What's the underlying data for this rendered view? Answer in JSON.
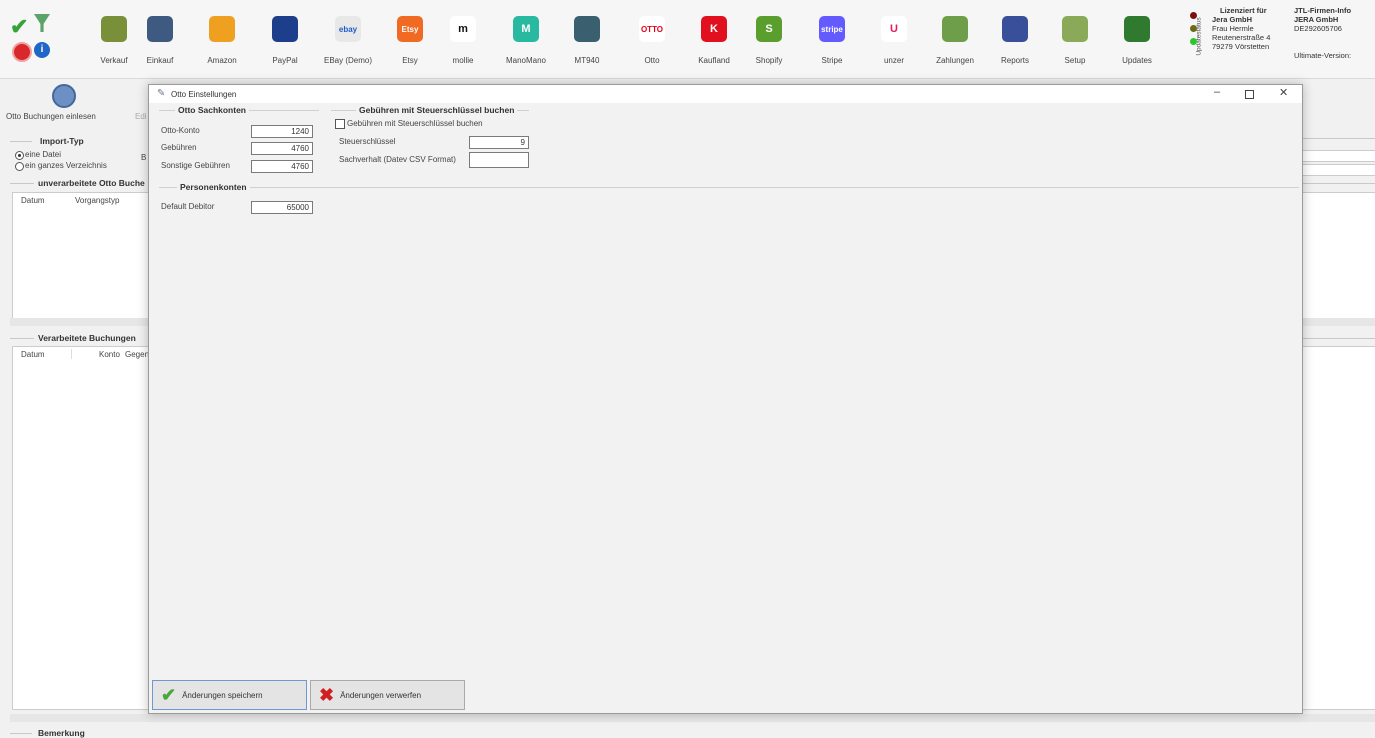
{
  "toolbar": {
    "items": [
      {
        "label": "Verkauf",
        "icon": "cart-icon"
      },
      {
        "label": "Einkauf",
        "icon": "purchase-icon"
      },
      {
        "label": "Amazon",
        "icon": "amazon-icon"
      },
      {
        "label": "PayPal",
        "icon": "paypal-icon"
      },
      {
        "label": "EBay (Demo)",
        "icon": "ebay-icon",
        "icon_text": "ebay"
      },
      {
        "label": "Etsy",
        "icon": "etsy-icon",
        "icon_text": "Etsy"
      },
      {
        "label": "mollie",
        "icon": "mollie-icon",
        "icon_text": "m"
      },
      {
        "label": "ManoMano",
        "icon": "manomano-icon",
        "icon_text": "M"
      },
      {
        "label": "MT940",
        "icon": "mt940-icon"
      },
      {
        "label": "Otto",
        "icon": "otto-icon",
        "icon_text": "OTTO"
      },
      {
        "label": "Kaufland",
        "icon": "kaufland-icon",
        "icon_text": "K"
      },
      {
        "label": "Shopify",
        "icon": "shopify-icon",
        "icon_text": "S"
      },
      {
        "label": "Stripe",
        "icon": "stripe-icon",
        "icon_text": "stripe"
      },
      {
        "label": "unzer",
        "icon": "unzer-icon",
        "icon_text": "U"
      },
      {
        "label": "Zahlungen",
        "icon": "payments-icon"
      },
      {
        "label": "Reports",
        "icon": "reports-icon"
      },
      {
        "label": "Setup",
        "icon": "setup-icon"
      },
      {
        "label": "Updates",
        "icon": "updates-icon"
      }
    ]
  },
  "license": {
    "vertical_label": "Updatestatus",
    "heading": "Lizenziert für",
    "company": "Jera GmbH",
    "contact": "Frau Hermle",
    "street": "Reutenerstraße 4",
    "city": "79279 Vörstetten",
    "jtl_heading": "JTL-Firmen-Info",
    "jtl_company": "JERA GmbH",
    "jtl_id": "DE292605706",
    "version_label": "Ultimate-Version:"
  },
  "background": {
    "import_button_label": "Otto Buchungen einlesen",
    "import_type_heading": "Import-Typ",
    "radio_file": "eine Datei",
    "radio_folder": "ein ganzes Verzeichnis",
    "unprocessed_heading": "unverarbeitete Otto Buche",
    "unprocessed_cols": [
      "Datum",
      "Vorgangstyp"
    ],
    "processed_heading": "Verarbeitete Buchungen",
    "processed_cols": [
      "Datum",
      "Konto",
      "Gegen"
    ],
    "bemerkung_heading": "Bemerkung"
  },
  "dialog": {
    "title": "Otto Einstellungen",
    "sachkonten_heading": "Otto Sachkonten",
    "otto_konto_label": "Otto-Konto",
    "otto_konto_value": "1240",
    "gebuehren_label": "Gebühren",
    "gebuehren_value": "4760",
    "sonstige_label": "Sonstige Gebühren",
    "sonstige_value": "4760",
    "personenkonten_heading": "Personenkonten",
    "debitor_label": "Default Debitor",
    "debitor_value": "65000",
    "steuer_heading": "Gebühren mit Steuerschlüssel buchen",
    "steuer_checkbox_label": "Gebühren mit Steuerschlüssel buchen",
    "steuerschluessel_label": "Steuerschlüssel",
    "steuerschluessel_value": "9",
    "sachverhalt_label": "Sachverhalt (Datev CSV Format)",
    "sachverhalt_value": "",
    "save_label": "Änderungen speichern",
    "discard_label": "Änderungen verwerfen"
  }
}
